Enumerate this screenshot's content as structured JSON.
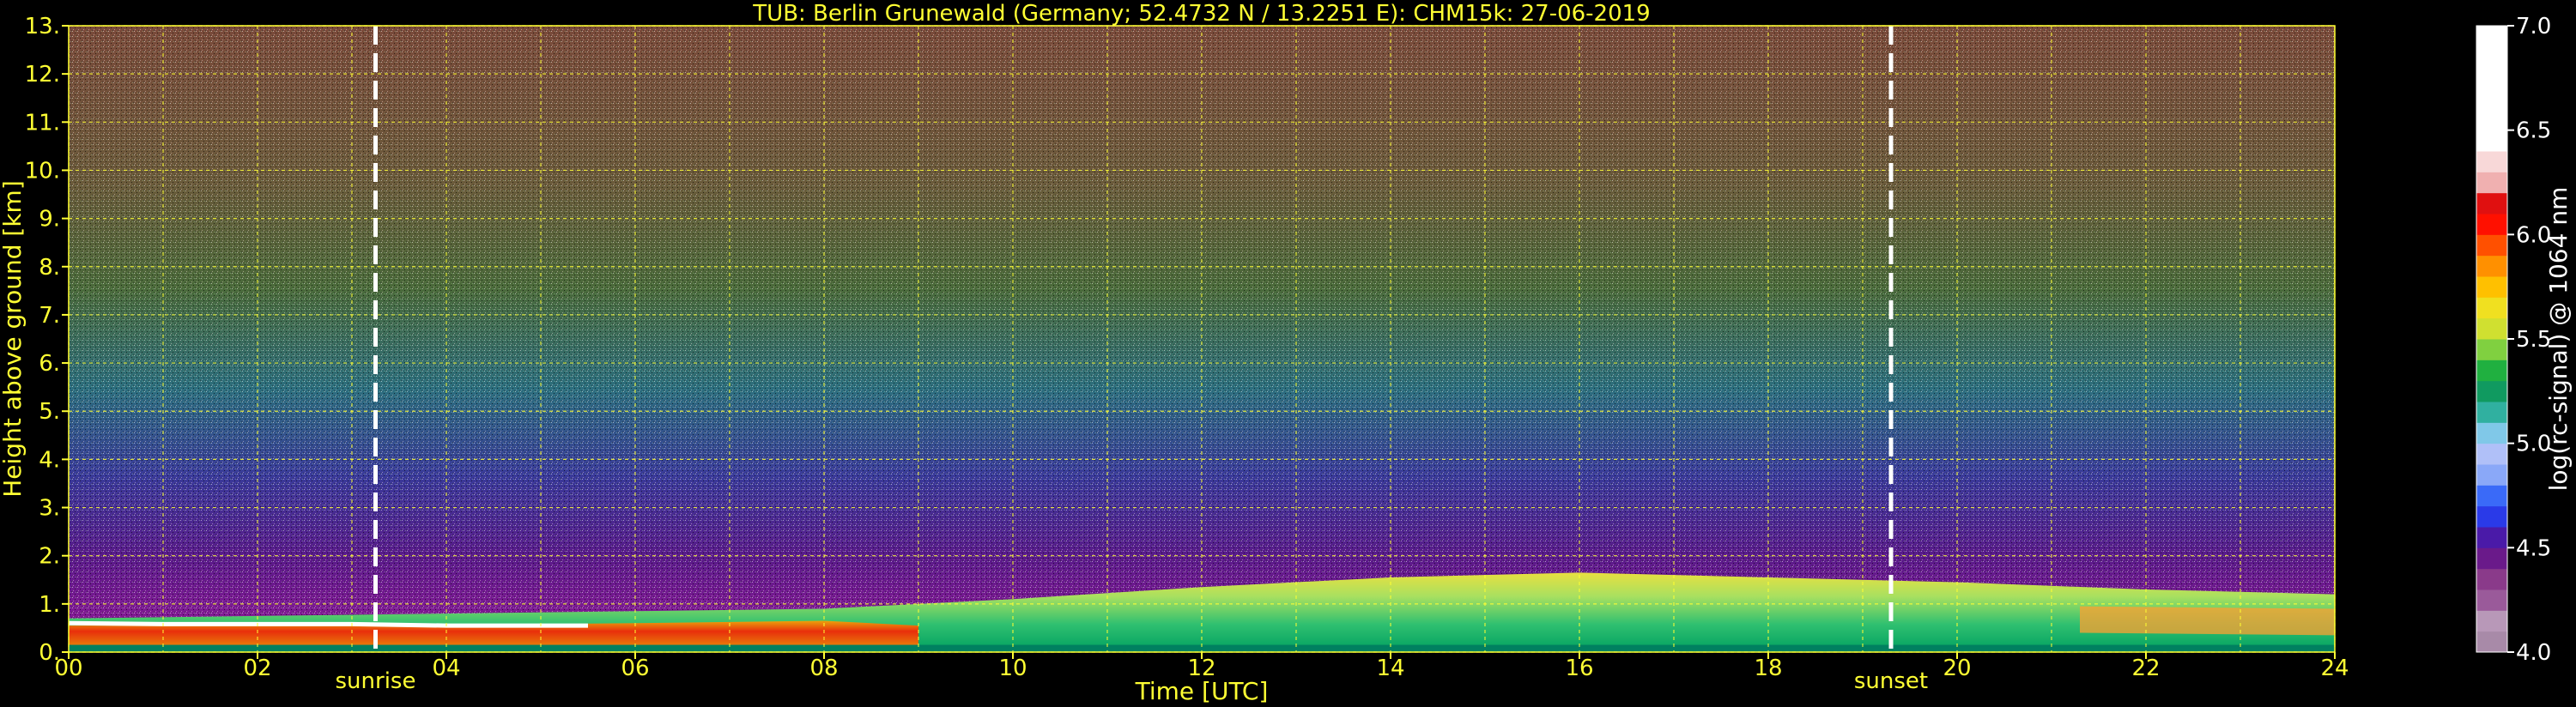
{
  "chart_data": {
    "type": "heatmap",
    "title": "TUB: Berlin Grunewald (Germany; 52.4732 N / 13.2251 E):    CHM15k: 27-06-2019",
    "xlabel": "Time [UTC]",
    "ylabel": "Height above ground [km]",
    "xlim": [
      0,
      24
    ],
    "ylim": [
      0,
      13
    ],
    "x_ticks": [
      "00",
      "02",
      "04",
      "06",
      "08",
      "10",
      "12",
      "14",
      "16",
      "18",
      "20",
      "22",
      "24"
    ],
    "y_ticks": [
      "0.",
      "1.",
      "2.",
      "3.",
      "4.",
      "5.",
      "6.",
      "7.",
      "8.",
      "9.",
      "10.",
      "11.",
      "12.",
      "13."
    ],
    "grid": true,
    "markers": [
      {
        "label": "sunrise",
        "time": 3.25
      },
      {
        "label": "sunset",
        "time": 19.3
      }
    ],
    "colorbar": {
      "label": "log(rc-signal) @ 1064 nm",
      "range": [
        4.0,
        7.0
      ],
      "ticks": [
        "4.0",
        "4.5",
        "5.0",
        "5.5",
        "6.0",
        "6.5",
        "7.0"
      ]
    },
    "boundary_layer_top_km": [
      [
        0,
        0.7
      ],
      [
        2,
        0.75
      ],
      [
        4,
        0.8
      ],
      [
        6,
        0.85
      ],
      [
        8,
        0.9
      ],
      [
        10,
        1.1
      ],
      [
        12,
        1.35
      ],
      [
        14,
        1.55
      ],
      [
        16,
        1.65
      ],
      [
        18,
        1.55
      ],
      [
        20,
        1.45
      ],
      [
        22,
        1.3
      ],
      [
        24,
        1.2
      ]
    ]
  }
}
